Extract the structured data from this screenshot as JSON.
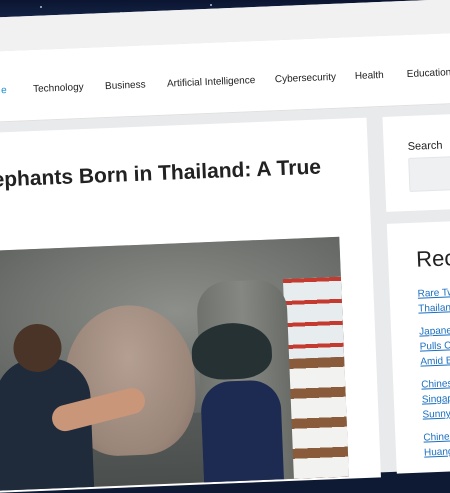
{
  "nav": {
    "items": [
      {
        "label": "e",
        "active": true
      },
      {
        "label": "Technology",
        "active": false
      },
      {
        "label": "Business",
        "active": false
      },
      {
        "label": "Artificial Intelligence",
        "active": false
      },
      {
        "label": "Cybersecurity",
        "active": false
      },
      {
        "label": "Health",
        "active": false
      },
      {
        "label": "Education",
        "active": false
      }
    ]
  },
  "article": {
    "headline": "lephants Born in Thailand: A True"
  },
  "sidebar": {
    "search_label": "Search",
    "recent_title": "Rece",
    "recent_items": [
      [
        "Rare Twi",
        "Thailand:"
      ],
      [
        "Japanese",
        "Pulls Co",
        "Amid Bac"
      ],
      [
        "Chinese",
        "Singapo",
        "Sunny a"
      ],
      [
        "Chinese",
        "Huang J"
      ]
    ]
  },
  "colors": {
    "accent_link": "#1b6fc0",
    "active_nav": "#1b8fd1"
  }
}
